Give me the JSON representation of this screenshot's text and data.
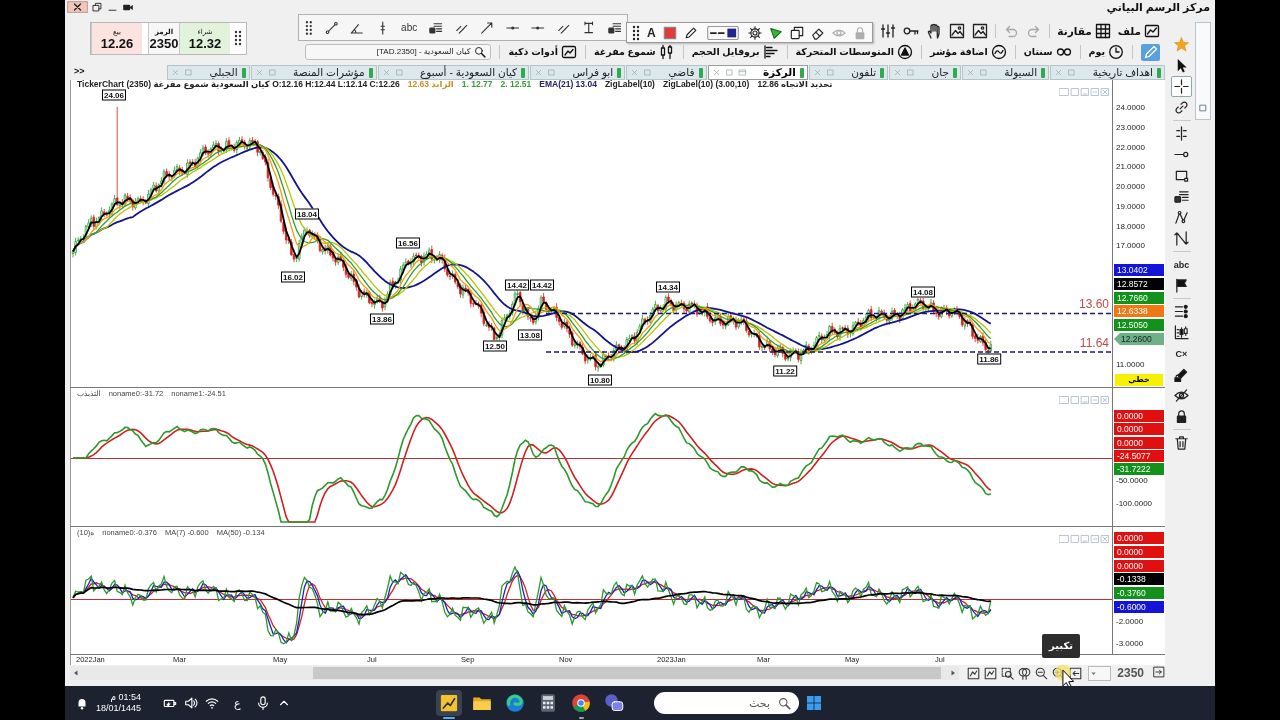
{
  "window": {
    "title": "مركز الرسم البياني"
  },
  "quote": [
    {
      "kind": "ask",
      "label": "شراء",
      "value": "12.32"
    },
    {
      "kind": "symbol",
      "label": "الرمز",
      "value": "2350"
    },
    {
      "kind": "bid",
      "label": "بيع",
      "value": "12.26"
    }
  ],
  "toolbar": {
    "menus": [
      {
        "kind": "file",
        "label": "ملف"
      },
      {
        "kind": "compare",
        "label": "مقارنة"
      }
    ],
    "tools": [
      {
        "kind": "redo",
        "disabled": true
      },
      {
        "kind": "undo",
        "disabled": true
      },
      {
        "kind": "picture",
        "disabled": false
      },
      {
        "kind": "picture",
        "disabled": false
      },
      {
        "kind": "hand",
        "disabled": false
      },
      {
        "kind": "key",
        "disabled": false
      },
      {
        "kind": "bars",
        "disabled": false
      }
    ]
  },
  "drawing_toolbar": {
    "tools": [
      {
        "kind": "segment"
      },
      {
        "kind": "angle"
      },
      {
        "kind": "vmark"
      },
      {
        "kind": "text",
        "label": "abc"
      },
      {
        "kind": "note"
      },
      {
        "kind": "channel"
      },
      {
        "kind": "ray"
      },
      {
        "kind": "hline"
      },
      {
        "kind": "hline"
      },
      {
        "kind": "channel"
      },
      {
        "kind": "measure"
      },
      {
        "kind": "note"
      }
    ]
  },
  "style_toolbar": {
    "tools": [
      {
        "kind": "font",
        "label": "A",
        "disabled": false
      },
      {
        "kind": "color",
        "color": "#e23b3b",
        "disabled": false
      },
      {
        "kind": "pencil",
        "disabled": false
      },
      {
        "kind": "line_style",
        "color": "#23238f",
        "disabled": false
      },
      {
        "kind": "gear",
        "disabled": false
      },
      {
        "kind": "fill",
        "color": "#3cb43c",
        "disabled": false
      },
      {
        "kind": "copy",
        "disabled": false
      },
      {
        "kind": "eraser",
        "disabled": false
      },
      {
        "kind": "eye",
        "disabled": true
      },
      {
        "kind": "lock",
        "disabled": true
      }
    ]
  },
  "chart_toolbar": {
    "draw_mode": {
      "on": true
    },
    "items": [
      {
        "kind": "period",
        "label": "يوم"
      },
      {
        "kind": "range",
        "label": "سنتان"
      },
      {
        "kind": "indicator",
        "label": "اضافة مؤشر"
      },
      {
        "kind": "averages",
        "label": "المتوسطات المتحركة"
      },
      {
        "kind": "volume",
        "label": "بروفايل الحجم"
      },
      {
        "kind": "candles_tb",
        "label": "شموع مفرغة"
      },
      {
        "kind": "smart",
        "label": "أدوات ذكية"
      }
    ],
    "search": {
      "value": "[TAD.2350] - كيان السعودية"
    }
  },
  "tabs": [
    {
      "label": "اهداف تاريخية",
      "selected": false
    },
    {
      "label": "السيولة",
      "selected": false
    },
    {
      "label": "جان",
      "selected": false
    },
    {
      "label": "تلفون",
      "selected": false
    },
    {
      "label": "الركزة",
      "selected": true
    },
    {
      "label": "فاضي",
      "selected": false
    },
    {
      "label": "ابو فراس",
      "selected": false
    },
    {
      "label": "كيان السعودية - أسبوع",
      "selected": false
    },
    {
      "label": "مؤشرات المنصة",
      "selected": false
    },
    {
      "label": "الجبلي",
      "selected": false
    }
  ],
  "tabs_overflow": ">>",
  "price_pane": {
    "legend": [
      {
        "text": "تحديد الاتجاه 12.86",
        "color": "#222222"
      },
      {
        "text": "ZigLabel(10) (3.00,10)",
        "color": "#222222"
      },
      {
        "text": "ZigLabel(10)",
        "color": "#222222"
      },
      {
        "text": "EMA(21) 13.04",
        "color": "#23236e"
      },
      {
        "text": "2. 12.51",
        "color": "#3a9a3a"
      },
      {
        "text": "1. 12.77",
        "color": "#3a9a3a"
      },
      {
        "text": "الرابد 12.63",
        "color": "#c8902a"
      },
      {
        "text": "TickerChart كيان السعودية شموع مفرغة (2350) O:12.16 H:12.44 L:12.14 C:12.26",
        "color": "#222222"
      }
    ],
    "axis_labels": [
      "24.0000",
      "23.0000",
      "22.0000",
      "21.0000",
      "20.0000",
      "19.0000",
      "18.0000",
      "17.0000",
      "11.0000"
    ],
    "tags": [
      {
        "kind": "label",
        "text": "13.0402",
        "color": "#1414d8"
      },
      {
        "kind": "label",
        "text": "12.8572",
        "color": "#000000"
      },
      {
        "kind": "label",
        "text": "12.7660",
        "color": "#12921a"
      },
      {
        "kind": "label",
        "text": "12.6338",
        "color": "#f07814"
      },
      {
        "kind": "label",
        "text": "12.5050",
        "color": "#12921a"
      },
      {
        "kind": "pointer",
        "text": "12.2600",
        "color": "#6db184"
      }
    ],
    "chart_style": "خطي",
    "levels": [
      "13.60",
      "11.64"
    ],
    "zig_labels": [
      "24.06",
      "16.02",
      "18.04",
      "13.86",
      "16.56",
      "12.50",
      "14.42",
      "13.08",
      "14.42",
      "10.80",
      "14.34",
      "11.22",
      "14.08",
      "11.86"
    ]
  },
  "indicator_panes": [
    {
      "title": "التذبذب",
      "legend": [
        "noname1:-24.51",
        "noname0:-31.72"
      ],
      "tags": [
        {
          "text": "0.0000",
          "color": "#e01010"
        },
        {
          "text": "0.0000",
          "color": "#e01010"
        },
        {
          "text": "0.0000",
          "color": "#e01010"
        },
        {
          "text": "-24.5077",
          "color": "#e01010"
        },
        {
          "text": "-31.7222",
          "color": "#12921a"
        }
      ],
      "axis_labels": [
        "-50.0000",
        "-100.0000"
      ]
    },
    {
      "title": "(10)ه",
      "legend": [
        "MA(50) -0.134",
        "MA(7) -0.600",
        "noname0:-0.376"
      ],
      "tags": [
        {
          "text": "0.0000",
          "color": "#e01010"
        },
        {
          "text": "0.0000",
          "color": "#e01010"
        },
        {
          "text": "0.0000",
          "color": "#e01010"
        },
        {
          "text": "-0.1338",
          "color": "#000000"
        },
        {
          "text": "-0.3760",
          "color": "#12921a"
        },
        {
          "text": "-0.6000",
          "color": "#1414d8"
        }
      ],
      "axis_labels": [
        "-2.0000",
        "-3.0000"
      ]
    }
  ],
  "x_axis": [
    "Jul",
    "May",
    "Mar",
    "2023Jan",
    "Nov",
    "Sep",
    "Jul",
    "May",
    "Mar",
    "2022Jan"
  ],
  "bottom_bar": {
    "symbol": "2350",
    "tooltip": "تكبير"
  },
  "side_tools": [
    {
      "kind": "star",
      "selected": false
    },
    {
      "kind": "cursor",
      "selected": false
    },
    {
      "kind": "crosshair",
      "selected": true
    },
    {
      "kind": "link",
      "selected": false
    },
    {
      "kind": "vline",
      "selected": false
    },
    {
      "kind": "line",
      "selected": false
    },
    {
      "kind": "rect",
      "selected": false
    },
    {
      "kind": "note",
      "selected": false
    },
    {
      "kind": "pitchfork",
      "selected": false
    },
    {
      "kind": "zigzag",
      "selected": false
    },
    {
      "kind": "text",
      "label": "abc",
      "selected": false
    },
    {
      "kind": "flag",
      "selected": false
    },
    {
      "kind": "list",
      "selected": false
    },
    {
      "kind": "candles",
      "selected": false
    },
    {
      "kind": "clear",
      "label": "C×",
      "selected": false
    },
    {
      "kind": "pencil_lock",
      "selected": false
    },
    {
      "kind": "eye_off",
      "selected": false
    },
    {
      "kind": "lock",
      "selected": false
    },
    {
      "kind": "trash",
      "selected": false
    }
  ],
  "taskbar": {
    "time": "01:54 م",
    "date": "18/01/1445",
    "language": "ع",
    "apps": [
      {
        "kind": "app_chart",
        "active": true,
        "running": true
      },
      {
        "kind": "folder",
        "active": false,
        "running": false
      },
      {
        "kind": "edge",
        "active": false,
        "running": false
      },
      {
        "kind": "calc",
        "active": false,
        "running": false
      },
      {
        "kind": "chrome",
        "active": false,
        "running": true
      },
      {
        "kind": "chat",
        "active": false,
        "running": false
      }
    ],
    "search": {
      "placeholder": "بحث"
    }
  }
}
